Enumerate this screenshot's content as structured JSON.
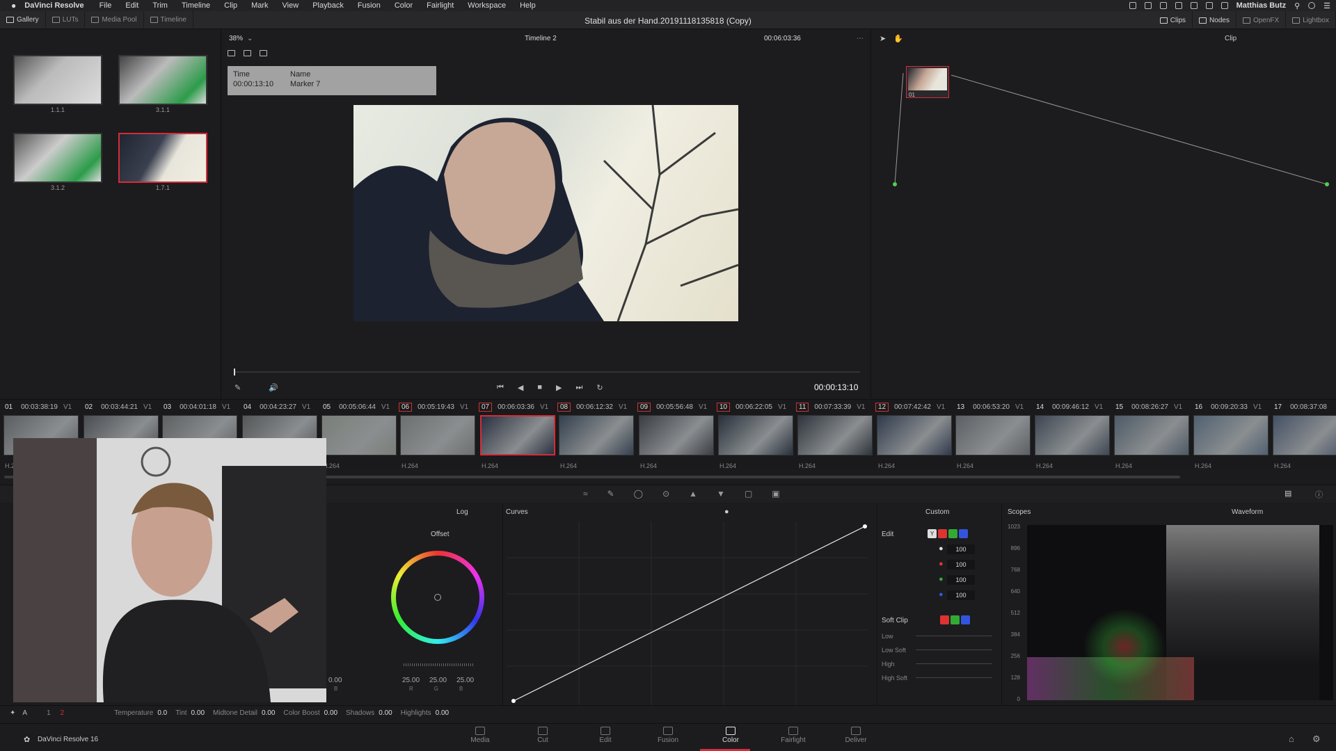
{
  "menubar": {
    "app": "DaVinci Resolve",
    "menus": [
      "File",
      "Edit",
      "Trim",
      "Timeline",
      "Clip",
      "Mark",
      "View",
      "Playback",
      "Fusion",
      "Color",
      "Fairlight",
      "Workspace",
      "Help"
    ],
    "user": "Matthias Butz"
  },
  "toolbar": {
    "left": [
      "Gallery",
      "LUTs",
      "Media Pool",
      "Timeline"
    ],
    "project_title": "Stabil aus der Hand.20191118135818 (Copy)",
    "right": [
      "Clips",
      "Nodes",
      "OpenFX",
      "Lightbox"
    ]
  },
  "viewer": {
    "zoom": "38%",
    "timeline_name": "Timeline 2",
    "timecode_top": "00:06:03:36",
    "mode": "Clip",
    "marker": {
      "time_label": "Time",
      "name_label": "Name",
      "time": "00:00:13:10",
      "name": "Marker 7"
    },
    "playhead_timecode": "00:00:13:10"
  },
  "gallery": {
    "stills": [
      {
        "label": "1.1.1"
      },
      {
        "label": "3.1.1"
      },
      {
        "label": "3.1.2"
      },
      {
        "label": "1.7.1",
        "selected": true
      }
    ]
  },
  "nodes": {
    "node_label": "01"
  },
  "clips": [
    {
      "num": "01",
      "tc": "00:03:38:19",
      "track": "V1",
      "codec": "H.264",
      "marked": false
    },
    {
      "num": "02",
      "tc": "00:03:44:21",
      "track": "V1",
      "codec": "H.264",
      "marked": false
    },
    {
      "num": "03",
      "tc": "00:04:01:18",
      "track": "V1",
      "codec": "H.264",
      "marked": false
    },
    {
      "num": "04",
      "tc": "00:04:23:27",
      "track": "V1",
      "codec": "H.264",
      "marked": false
    },
    {
      "num": "05",
      "tc": "00:05:06:44",
      "track": "V1",
      "codec": "H.264",
      "marked": false
    },
    {
      "num": "06",
      "tc": "00:05:19:43",
      "track": "V1",
      "codec": "H.264",
      "marked": true
    },
    {
      "num": "07",
      "tc": "00:06:03:36",
      "track": "V1",
      "codec": "H.264",
      "marked": true,
      "selected": true
    },
    {
      "num": "08",
      "tc": "00:06:12:32",
      "track": "V1",
      "codec": "H.264",
      "marked": true
    },
    {
      "num": "09",
      "tc": "00:05:56:48",
      "track": "V1",
      "codec": "H.264",
      "marked": true
    },
    {
      "num": "10",
      "tc": "00:06:22:05",
      "track": "V1",
      "codec": "H.264",
      "marked": true
    },
    {
      "num": "11",
      "tc": "00:07:33:39",
      "track": "V1",
      "codec": "H.264",
      "marked": true
    },
    {
      "num": "12",
      "tc": "00:07:42:42",
      "track": "V1",
      "codec": "H.264",
      "marked": true
    },
    {
      "num": "13",
      "tc": "00:06:53:20",
      "track": "V1",
      "codec": "H.264",
      "marked": false
    },
    {
      "num": "14",
      "tc": "00:09:46:12",
      "track": "V1",
      "codec": "H.264",
      "marked": false
    },
    {
      "num": "15",
      "tc": "00:08:26:27",
      "track": "V1",
      "codec": "H.264",
      "marked": false
    },
    {
      "num": "16",
      "tc": "00:09:20:33",
      "track": "V1",
      "codec": "H.264",
      "marked": false
    },
    {
      "num": "17",
      "tc": "00:08:37:08",
      "track": "",
      "codec": "H.264",
      "marked": false
    }
  ],
  "wheels": {
    "mode": "Log",
    "wheel_title": "Offset",
    "values": [
      "25.00",
      "25.00",
      "25.00"
    ],
    "channel_labels": [
      "R",
      "G",
      "B"
    ],
    "prev_value": "0.00",
    "prev_channel": "B"
  },
  "curves": {
    "title": "Curves",
    "preset": "Custom"
  },
  "curve_edit": {
    "edit_label": "Edit",
    "channels": [
      "Y",
      "R",
      "G",
      "B"
    ],
    "values": [
      "100",
      "100",
      "100",
      "100"
    ],
    "soft_clip_label": "Soft Clip",
    "soft_rows": [
      "Low",
      "Low Soft",
      "High",
      "High Soft"
    ]
  },
  "scopes": {
    "title": "Scopes",
    "type": "Waveform",
    "ticks": [
      "1023",
      "896",
      "768",
      "640",
      "512",
      "384",
      "256",
      "128",
      "0"
    ]
  },
  "adjust": {
    "page_nums": [
      "1",
      "2"
    ],
    "items": [
      {
        "label": "Temperature",
        "value": "0.0"
      },
      {
        "label": "Tint",
        "value": "0.00"
      },
      {
        "label": "Midtone Detail",
        "value": "0.00"
      },
      {
        "label": "Color Boost",
        "value": "0.00"
      },
      {
        "label": "Shadows",
        "value": "0.00"
      },
      {
        "label": "Highlights",
        "value": "0.00"
      }
    ]
  },
  "pages": {
    "brand": "DaVinci Resolve 16",
    "items": [
      "Media",
      "Cut",
      "Edit",
      "Fusion",
      "Color",
      "Fairlight",
      "Deliver"
    ],
    "active": "Color"
  },
  "colors": {
    "accent": "#d62b3a",
    "bg": "#1c1c1e"
  }
}
